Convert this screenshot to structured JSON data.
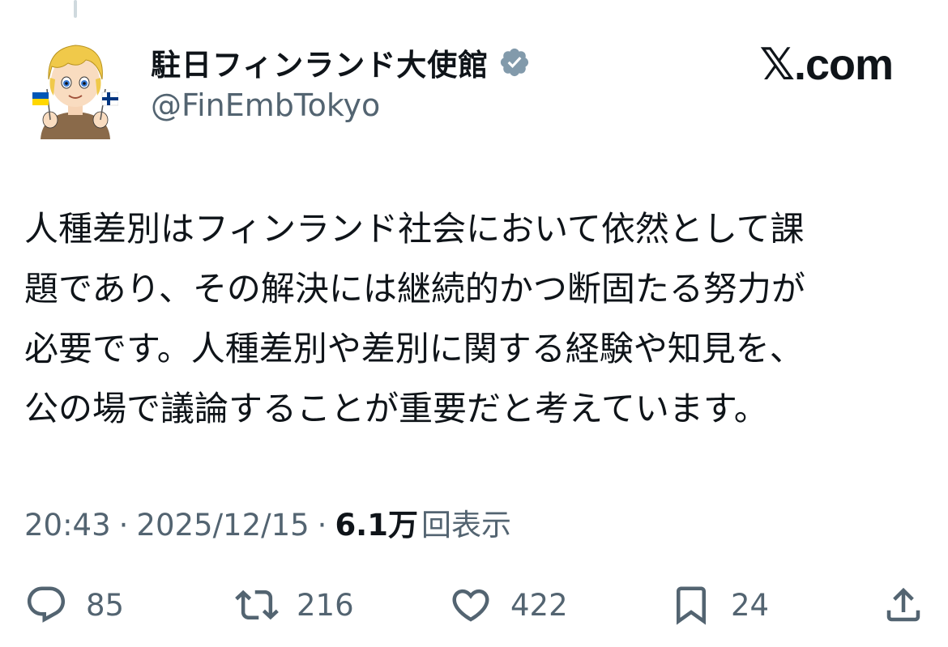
{
  "author": {
    "display_name": "駐日フィンランド大使館",
    "handle": "@FinEmbTokyo",
    "verified_icon": "verified-badge-icon",
    "avatar": "avatar-illustration"
  },
  "brand": {
    "label": "𝕏.com"
  },
  "tweet": {
    "lines": [
      "人種差別はフィンランド社会において依然として課",
      "題であり、その解決には継続的かつ断固たる努力が",
      "必要です。人種差別や差別に関する経験や知見を、",
      "公の場で議論することが重要だと考えています。"
    ]
  },
  "meta": {
    "time": "20:43",
    "separator": "·",
    "date": "2025/12/15",
    "views_count": "6.1万",
    "views_label": "回表示"
  },
  "actions": {
    "reply": {
      "icon": "reply-icon",
      "count": "85"
    },
    "retweet": {
      "icon": "retweet-icon",
      "count": "216"
    },
    "like": {
      "icon": "heart-icon",
      "count": "422"
    },
    "bookmark": {
      "icon": "bookmark-icon",
      "count": "24"
    },
    "share": {
      "icon": "share-icon"
    }
  },
  "colors": {
    "text": "#0f1419",
    "secondary": "#536471",
    "verified": "#829aab",
    "ukraine_blue": "#0057b7",
    "ukraine_yellow": "#ffd700",
    "finland_blue": "#003580"
  }
}
